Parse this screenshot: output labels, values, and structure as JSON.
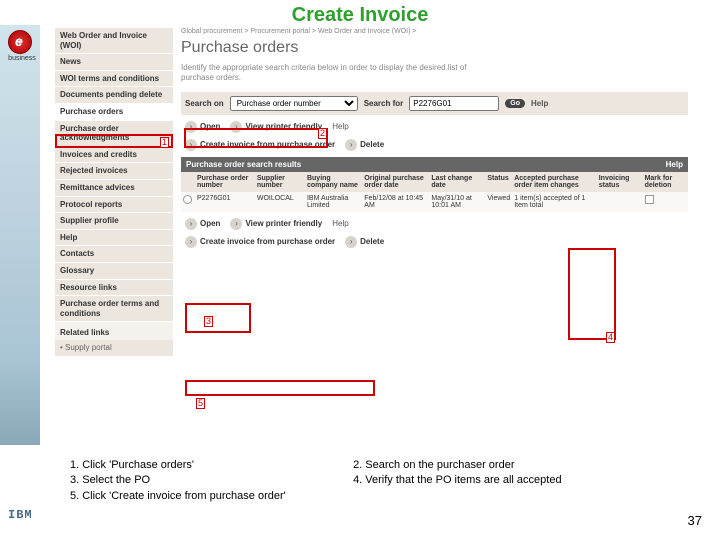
{
  "title": "Create Invoice",
  "logo_label": "business",
  "breadcrumb": "Global procurement > Procurement portal > Web Order and Invoice (WOI) >",
  "page_heading": "Purchase orders",
  "description": "Identify the appropriate search criteria below in order to display the desired list of purchase orders.",
  "sidebar": {
    "items": [
      "Web Order and Invoice (WOI)",
      "News",
      "WOI terms and conditions",
      "Documents pending delete",
      "Purchase orders",
      "Purchase order acknowledgments",
      "Invoices and credits",
      "Rejected invoices",
      "Remittance advices",
      "Protocol reports",
      "Supplier profile",
      "Help",
      "Contacts",
      "Glossary",
      "Resource links",
      "Purchase order terms and conditions"
    ],
    "related_heading": "Related links",
    "related_link": "• Supply portal"
  },
  "search": {
    "on_label": "Search on",
    "on_value": "Purchase order number",
    "for_label": "Search for",
    "for_value": "P2276G01",
    "go": "Go",
    "help": "Help"
  },
  "actions": {
    "open": "Open",
    "printer": "View printer friendly",
    "create": "Create invoice from purchase order",
    "delete": "Delete",
    "help": "Help"
  },
  "results": {
    "title": "Purchase order search results",
    "help": "Help",
    "cols": [
      "",
      "Purchase order number",
      "Supplier number",
      "Buying company name",
      "Original purchase order date",
      "Last change date",
      "Status",
      "Accepted purchase order item changes",
      "Invoicing status",
      "Mark for deletion"
    ],
    "row": {
      "po": "P2276G01",
      "supplier": "WOILOCAL",
      "company": "IBM Australia Limited",
      "orig": "Feb/12/08 at 10:45 AM",
      "last": "May/31/10 at 10:01 AM",
      "status": "Viewed",
      "accepted": "1 item(s) accepted of 1 Item total"
    }
  },
  "markers": {
    "m1": "1",
    "m2": "2",
    "m3": "3",
    "m4": "4",
    "m5": "5"
  },
  "instructions": {
    "i1": "1. Click 'Purchase orders'",
    "i2": "2. Search on the purchaser order",
    "i3": "3. Select the PO",
    "i4": "4. Verify that the PO items are all accepted",
    "i5": "5. Click 'Create invoice from purchase order'"
  },
  "page_number": "37"
}
